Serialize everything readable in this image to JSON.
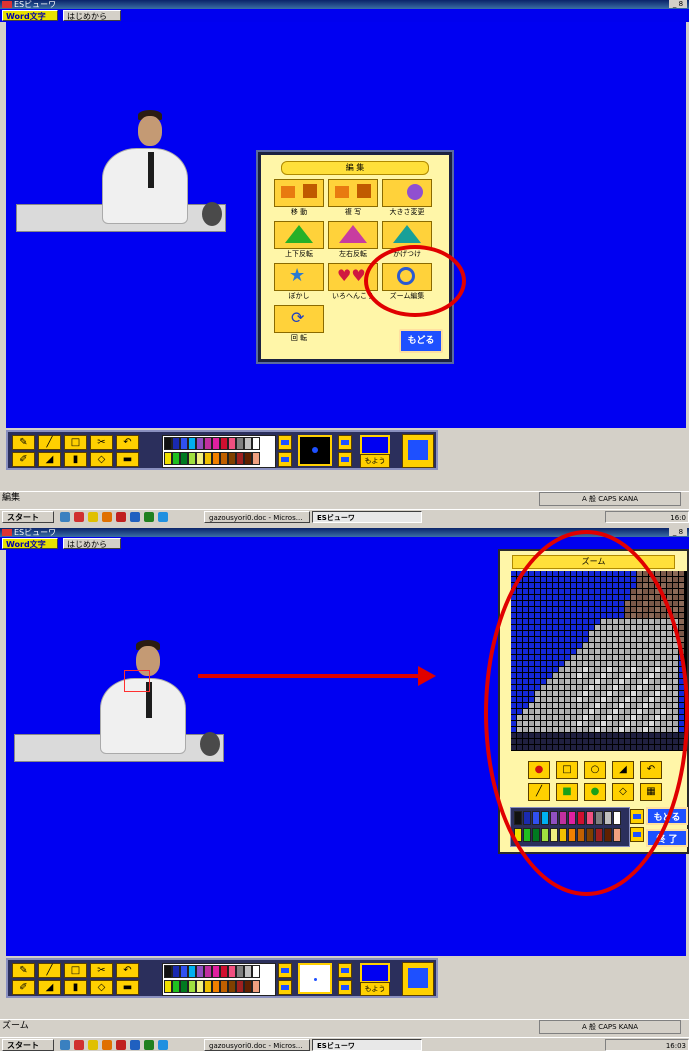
{
  "window": {
    "title": "ESビューワ",
    "controls": "_ 8"
  },
  "menubar": {
    "word_button": "Word文字",
    "restart_button": "はじめから"
  },
  "edit_dialog": {
    "title": "編 集",
    "tiles": [
      {
        "label": "移 動",
        "icon": "move-icon"
      },
      {
        "label": "複 写",
        "icon": "copy-icon"
      },
      {
        "label": "大きさ変更",
        "icon": "resize-icon"
      },
      {
        "label": "上下反転",
        "icon": "flip-vertical-icon"
      },
      {
        "label": "左右反転",
        "icon": "flip-horizontal-icon"
      },
      {
        "label": "かげつけ",
        "icon": "shadow-icon"
      },
      {
        "label": "ぼかし",
        "icon": "blur-icon"
      },
      {
        "label": "いろへんこう",
        "icon": "color-change-icon"
      },
      {
        "label": "ズーム編集",
        "icon": "zoom-edit-icon"
      },
      {
        "label": "回 転",
        "icon": "rotate-icon"
      }
    ],
    "back_button": "もどる"
  },
  "zoom_window": {
    "title": "ズーム",
    "back_button": "もどる",
    "end_button": "終 了"
  },
  "toolbar": {
    "pattern_button": "もよう"
  },
  "status_top": "編集",
  "status_bottom": "ズーム",
  "ime_tray": "A 般",
  "caps": "CAPS KANA",
  "taskbar": {
    "start_label": "スタート",
    "tasks": [
      "gazousyori0.doc - Micros...",
      "ESビューワ"
    ],
    "clock_top": "16:0",
    "clock_bottom": "16:03"
  },
  "colors": {
    "canvas_blue": "#0000f2",
    "annotation_red": "#e00000",
    "tile_yellow": "#ffd23a"
  }
}
